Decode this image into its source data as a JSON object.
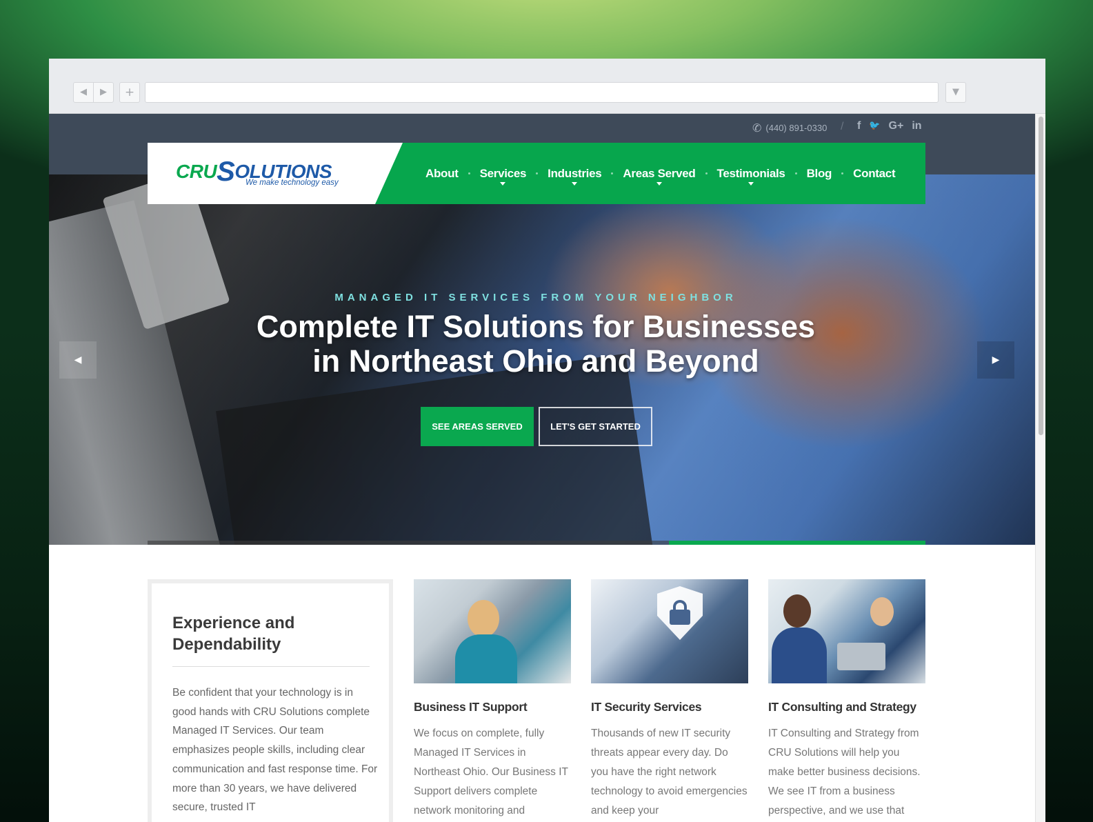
{
  "browser": {
    "back_icon": "◀",
    "forward_icon": "▶",
    "new_tab_icon": "+",
    "menu_icon": "▼",
    "url": ""
  },
  "topbar": {
    "phone": "(440) 891-0330",
    "phone_icon": "✆",
    "divider": "/",
    "socials": [
      {
        "name": "facebook-icon",
        "glyph": "f"
      },
      {
        "name": "twitter-icon",
        "glyph": "🐦"
      },
      {
        "name": "google-plus-icon",
        "glyph": "G+"
      },
      {
        "name": "linkedin-icon",
        "glyph": "in"
      }
    ]
  },
  "logo": {
    "part1": "CRU",
    "part2": "S",
    "part3": "OLUTIONS",
    "tagline": "We make technology easy"
  },
  "nav": {
    "items": [
      {
        "label": "About",
        "dropdown": false
      },
      {
        "label": "Services",
        "dropdown": true
      },
      {
        "label": "Industries",
        "dropdown": true
      },
      {
        "label": "Areas Served",
        "dropdown": true
      },
      {
        "label": "Testimonials",
        "dropdown": true
      },
      {
        "label": "Blog",
        "dropdown": false
      },
      {
        "label": "Contact",
        "dropdown": false
      }
    ]
  },
  "hero": {
    "eyebrow": "MANAGED IT SERVICES FROM YOUR NEIGHBOR",
    "title_line1": "Complete IT Solutions for Businesses",
    "title_line2": "in Northeast Ohio and Beyond",
    "primary_button": "SEE AREAS SERVED",
    "secondary_button": "LET'S GET STARTED",
    "prev_icon": "◀",
    "next_icon": "▶",
    "slide_progress": 0.67
  },
  "experience": {
    "title": "Experience and Dependability",
    "text": "Be confident that your technology is in good hands with CRU Solutions complete Managed IT Services. Our team emphasizes people skills, including clear communication and fast response time. For more than 30 years, we have delivered secure, trusted IT"
  },
  "services": [
    {
      "title": "Business IT Support",
      "text": "We focus on complete, fully Managed IT Services in Northeast Ohio. Our Business IT Support delivers complete network monitoring and"
    },
    {
      "title": "IT Security Services",
      "text": "Thousands of new IT security threats appear every day. Do you have the right network technology to avoid emergencies and keep your"
    },
    {
      "title": "IT Consulting and Strategy",
      "text": "IT Consulting and Strategy from CRU Solutions will help you make better business decisions. We see IT from a business perspective, and we use that"
    }
  ],
  "colors": {
    "brand_green": "#07a64d",
    "brand_blue": "#1e5aa8",
    "topbar": "#3e4a59",
    "eyebrow": "#7fe0e0"
  }
}
